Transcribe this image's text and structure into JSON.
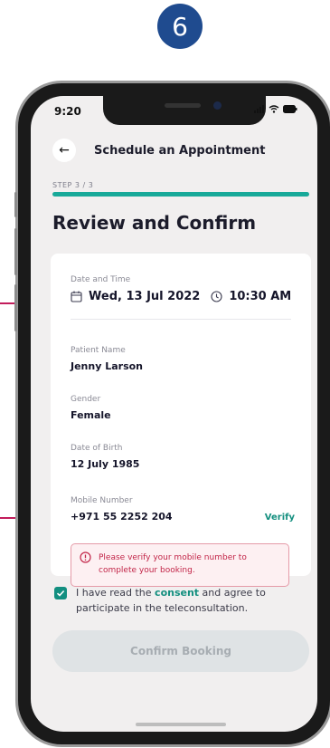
{
  "step_badge": "6",
  "status": {
    "time": "9:20"
  },
  "header": {
    "back_icon": "arrow-left-icon",
    "title": "Schedule an Appointment"
  },
  "progress": {
    "step_label": "STEP 3 / 3",
    "fraction": 1.0
  },
  "page_title": "Review and Confirm",
  "review": {
    "date_time_label": "Date and Time",
    "date": "Wed, 13 Jul 2022",
    "time": "10:30 AM",
    "patient_name_label": "Patient Name",
    "patient_name": "Jenny Larson",
    "gender_label": "Gender",
    "gender": "Female",
    "dob_label": "Date of Birth",
    "dob": "12 July 1985",
    "mobile_label": "Mobile Number",
    "mobile": "+971 55 2252 204",
    "verify_label": "Verify",
    "warning": "Please verify your mobile number to complete your booking."
  },
  "consent": {
    "checked": true,
    "prefix": "I have read the ",
    "link": "consent",
    "suffix": " and agree to participate in the teleconsultation."
  },
  "confirm_button": "Confirm Booking",
  "colors": {
    "accent": "#18a999",
    "badge": "#1f4b8f",
    "pointer": "#c21c5b",
    "warning": "#c22548"
  }
}
